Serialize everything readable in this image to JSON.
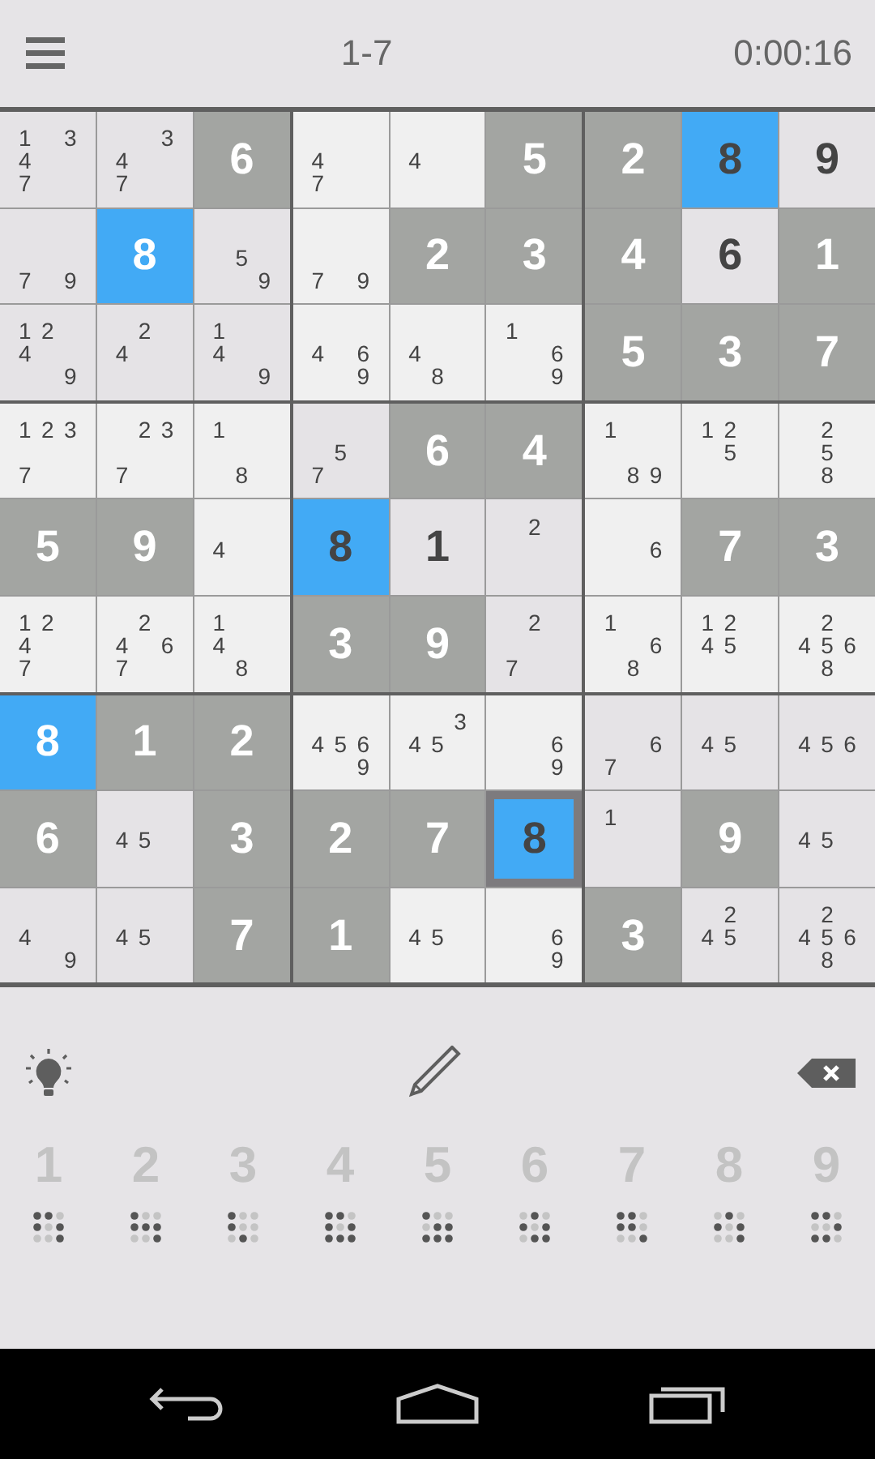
{
  "header": {
    "level": "1-7",
    "timer": "0:00:16"
  },
  "board": {
    "rows": [
      [
        {
          "kind": "notes",
          "notes": [
            "1",
            "3",
            "4",
            "7"
          ],
          "selected": false,
          "highlighted": false
        },
        {
          "kind": "notes",
          "notes": [
            "3",
            "4",
            "7"
          ],
          "selected": false,
          "highlighted": false
        },
        {
          "kind": "given",
          "value": "6",
          "selected": false,
          "highlighted": false
        },
        {
          "kind": "notes",
          "notes": [
            "4",
            "7"
          ],
          "selected": false,
          "highlighted": false
        },
        {
          "kind": "notes",
          "notes": [
            "4"
          ],
          "selected": false,
          "highlighted": false
        },
        {
          "kind": "given",
          "value": "5",
          "selected": false,
          "highlighted": false
        },
        {
          "kind": "given",
          "value": "2",
          "selected": false,
          "highlighted": false
        },
        {
          "kind": "entered",
          "value": "8",
          "selected": false,
          "highlighted": true
        },
        {
          "kind": "entered",
          "value": "9",
          "selected": false,
          "highlighted": false
        }
      ],
      [
        {
          "kind": "notes",
          "notes": [
            "7",
            "9"
          ],
          "selected": false,
          "highlighted": false
        },
        {
          "kind": "given",
          "value": "8",
          "selected": false,
          "highlighted": true
        },
        {
          "kind": "notes",
          "notes": [
            "5",
            "9"
          ],
          "selected": false,
          "highlighted": false
        },
        {
          "kind": "notes",
          "notes": [
            "7",
            "9"
          ],
          "selected": false,
          "highlighted": false
        },
        {
          "kind": "given",
          "value": "2",
          "selected": false,
          "highlighted": false
        },
        {
          "kind": "given",
          "value": "3",
          "selected": false,
          "highlighted": false
        },
        {
          "kind": "given",
          "value": "4",
          "selected": false,
          "highlighted": false
        },
        {
          "kind": "entered",
          "value": "6",
          "selected": false,
          "highlighted": false
        },
        {
          "kind": "given",
          "value": "1",
          "selected": false,
          "highlighted": false
        }
      ],
      [
        {
          "kind": "notes",
          "notes": [
            "1",
            "2",
            "4",
            "9"
          ],
          "selected": false,
          "highlighted": false
        },
        {
          "kind": "notes",
          "notes": [
            "2",
            "4"
          ],
          "selected": false,
          "highlighted": false
        },
        {
          "kind": "notes",
          "notes": [
            "1",
            "4",
            "9"
          ],
          "selected": false,
          "highlighted": false
        },
        {
          "kind": "notes",
          "notes": [
            "4",
            "6",
            "9"
          ],
          "selected": false,
          "highlighted": false
        },
        {
          "kind": "notes",
          "notes": [
            "4",
            "8"
          ],
          "selected": false,
          "highlighted": false
        },
        {
          "kind": "notes",
          "notes": [
            "1",
            "6",
            "9"
          ],
          "selected": false,
          "highlighted": false
        },
        {
          "kind": "given",
          "value": "5",
          "selected": false,
          "highlighted": false
        },
        {
          "kind": "given",
          "value": "3",
          "selected": false,
          "highlighted": false
        },
        {
          "kind": "given",
          "value": "7",
          "selected": false,
          "highlighted": false
        }
      ],
      [
        {
          "kind": "notes",
          "notes": [
            "1",
            "2",
            "3",
            "7"
          ],
          "selected": false,
          "highlighted": false
        },
        {
          "kind": "notes",
          "notes": [
            "2",
            "3",
            "7"
          ],
          "selected": false,
          "highlighted": false
        },
        {
          "kind": "notes",
          "notes": [
            "1",
            "8"
          ],
          "selected": false,
          "highlighted": false
        },
        {
          "kind": "notes",
          "notes": [
            "5",
            "7"
          ],
          "selected": false,
          "highlighted": false
        },
        {
          "kind": "given",
          "value": "6",
          "selected": false,
          "highlighted": false
        },
        {
          "kind": "given",
          "value": "4",
          "selected": false,
          "highlighted": false
        },
        {
          "kind": "notes",
          "notes": [
            "1",
            "8",
            "9"
          ],
          "selected": false,
          "highlighted": false
        },
        {
          "kind": "notes",
          "notes": [
            "1",
            "2",
            "5"
          ],
          "selected": false,
          "highlighted": false
        },
        {
          "kind": "notes",
          "notes": [
            "2",
            "5",
            "8"
          ],
          "selected": false,
          "highlighted": false
        }
      ],
      [
        {
          "kind": "given",
          "value": "5",
          "selected": false,
          "highlighted": false
        },
        {
          "kind": "given",
          "value": "9",
          "selected": false,
          "highlighted": false
        },
        {
          "kind": "notes",
          "notes": [
            "4"
          ],
          "selected": false,
          "highlighted": false
        },
        {
          "kind": "entered",
          "value": "8",
          "selected": false,
          "highlighted": true
        },
        {
          "kind": "entered",
          "value": "1",
          "selected": false,
          "highlighted": false
        },
        {
          "kind": "notes",
          "notes": [
            "2"
          ],
          "selected": false,
          "highlighted": false
        },
        {
          "kind": "notes",
          "notes": [
            "6"
          ],
          "selected": false,
          "highlighted": false
        },
        {
          "kind": "given",
          "value": "7",
          "selected": false,
          "highlighted": false
        },
        {
          "kind": "given",
          "value": "3",
          "selected": false,
          "highlighted": false
        }
      ],
      [
        {
          "kind": "notes",
          "notes": [
            "1",
            "2",
            "4",
            "7"
          ],
          "selected": false,
          "highlighted": false
        },
        {
          "kind": "notes",
          "notes": [
            "2",
            "4",
            "6",
            "7"
          ],
          "selected": false,
          "highlighted": false
        },
        {
          "kind": "notes",
          "notes": [
            "1",
            "4",
            "8"
          ],
          "selected": false,
          "highlighted": false
        },
        {
          "kind": "given",
          "value": "3",
          "selected": false,
          "highlighted": false
        },
        {
          "kind": "given",
          "value": "9",
          "selected": false,
          "highlighted": false
        },
        {
          "kind": "notes",
          "notes": [
            "2",
            "7"
          ],
          "selected": false,
          "highlighted": false
        },
        {
          "kind": "notes",
          "notes": [
            "1",
            "6",
            "8"
          ],
          "selected": false,
          "highlighted": false
        },
        {
          "kind": "notes",
          "notes": [
            "1",
            "2",
            "4",
            "5"
          ],
          "selected": false,
          "highlighted": false
        },
        {
          "kind": "notes",
          "notes": [
            "2",
            "4",
            "5",
            "6",
            "8"
          ],
          "selected": false,
          "highlighted": false
        }
      ],
      [
        {
          "kind": "given",
          "value": "8",
          "selected": false,
          "highlighted": true
        },
        {
          "kind": "given",
          "value": "1",
          "selected": false,
          "highlighted": false
        },
        {
          "kind": "given",
          "value": "2",
          "selected": false,
          "highlighted": false
        },
        {
          "kind": "notes",
          "notes": [
            "4",
            "5",
            "6",
            "9"
          ],
          "selected": false,
          "highlighted": false
        },
        {
          "kind": "notes",
          "notes": [
            "3",
            "4",
            "5"
          ],
          "selected": false,
          "highlighted": false
        },
        {
          "kind": "notes",
          "notes": [
            "6",
            "9"
          ],
          "selected": false,
          "highlighted": false
        },
        {
          "kind": "notes",
          "notes": [
            "6",
            "7"
          ],
          "selected": false,
          "highlighted": false
        },
        {
          "kind": "notes",
          "notes": [
            "4",
            "5"
          ],
          "selected": false,
          "highlighted": false
        },
        {
          "kind": "notes",
          "notes": [
            "4",
            "5",
            "6"
          ],
          "selected": false,
          "highlighted": false
        }
      ],
      [
        {
          "kind": "given",
          "value": "6",
          "selected": false,
          "highlighted": false
        },
        {
          "kind": "notes",
          "notes": [
            "4",
            "5"
          ],
          "selected": false,
          "highlighted": false
        },
        {
          "kind": "given",
          "value": "3",
          "selected": false,
          "highlighted": false
        },
        {
          "kind": "given",
          "value": "2",
          "selected": false,
          "highlighted": false
        },
        {
          "kind": "given",
          "value": "7",
          "selected": false,
          "highlighted": false
        },
        {
          "kind": "entered",
          "value": "8",
          "selected": true,
          "highlighted": true
        },
        {
          "kind": "notes",
          "notes": [
            "1"
          ],
          "selected": false,
          "highlighted": false
        },
        {
          "kind": "given",
          "value": "9",
          "selected": false,
          "highlighted": false
        },
        {
          "kind": "notes",
          "notes": [
            "4",
            "5"
          ],
          "selected": false,
          "highlighted": false
        }
      ],
      [
        {
          "kind": "notes",
          "notes": [
            "4",
            "9"
          ],
          "selected": false,
          "highlighted": false
        },
        {
          "kind": "notes",
          "notes": [
            "4",
            "5"
          ],
          "selected": false,
          "highlighted": false
        },
        {
          "kind": "given",
          "value": "7",
          "selected": false,
          "highlighted": false
        },
        {
          "kind": "given",
          "value": "1",
          "selected": false,
          "highlighted": false
        },
        {
          "kind": "notes",
          "notes": [
            "4",
            "5"
          ],
          "selected": false,
          "highlighted": false
        },
        {
          "kind": "notes",
          "notes": [
            "6",
            "9"
          ],
          "selected": false,
          "highlighted": false
        },
        {
          "kind": "given",
          "value": "3",
          "selected": false,
          "highlighted": false
        },
        {
          "kind": "notes",
          "notes": [
            "2",
            "4",
            "5"
          ],
          "selected": false,
          "highlighted": false
        },
        {
          "kind": "notes",
          "notes": [
            "2",
            "4",
            "5",
            "6",
            "8"
          ],
          "selected": false,
          "highlighted": false
        }
      ]
    ]
  },
  "keypad": [
    {
      "label": "1",
      "done": [
        false,
        false,
        true,
        false,
        true,
        false,
        true,
        true,
        false
      ]
    },
    {
      "label": "2",
      "done": [
        false,
        true,
        true,
        false,
        false,
        false,
        true,
        true,
        false
      ]
    },
    {
      "label": "3",
      "done": [
        false,
        true,
        true,
        false,
        true,
        true,
        true,
        false,
        true
      ]
    },
    {
      "label": "4",
      "done": [
        false,
        false,
        true,
        false,
        true,
        false,
        false,
        false,
        false
      ]
    },
    {
      "label": "5",
      "done": [
        false,
        true,
        true,
        true,
        false,
        false,
        false,
        false,
        false
      ]
    },
    {
      "label": "6",
      "done": [
        true,
        false,
        true,
        false,
        true,
        false,
        true,
        false,
        false
      ]
    },
    {
      "label": "7",
      "done": [
        false,
        false,
        true,
        false,
        false,
        true,
        true,
        true,
        false
      ]
    },
    {
      "label": "8",
      "done": [
        true,
        false,
        true,
        false,
        true,
        false,
        true,
        true,
        false
      ]
    },
    {
      "label": "9",
      "done": [
        false,
        false,
        true,
        true,
        true,
        false,
        false,
        false,
        true
      ]
    }
  ]
}
